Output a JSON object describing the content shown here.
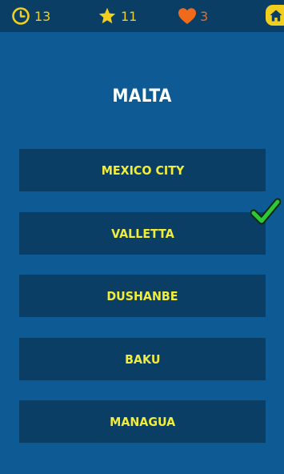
{
  "stats": {
    "time_left": "13",
    "stars": "11",
    "lives": "3"
  },
  "question": {
    "country": "MALTA"
  },
  "answers": [
    {
      "label": "MEXICO CITY",
      "correct": false
    },
    {
      "label": "VALLETTA",
      "correct": true
    },
    {
      "label": "DUSHANBE",
      "correct": false
    },
    {
      "label": "BAKU",
      "correct": false
    },
    {
      "label": "MANAGUA",
      "correct": false
    }
  ],
  "icons": {
    "timer": "clock-icon",
    "stars": "star-icon",
    "lives": "heart-icon",
    "home": "home-icon",
    "correct": "checkmark-icon"
  },
  "colors": {
    "background": "#0d5a94",
    "panel": "#0a3e64",
    "answer_text": "#f2ec3a",
    "stat_yellow": "#f2cf1e",
    "heart": "#f06a1c",
    "check": "#2fc63a"
  }
}
